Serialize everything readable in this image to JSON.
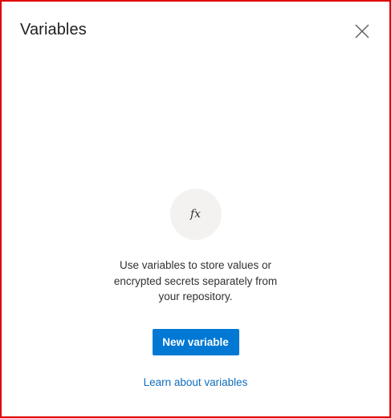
{
  "dialog": {
    "title": "Variables",
    "close_icon": "close-icon"
  },
  "empty_state": {
    "icon_text": "fx",
    "message": "Use variables to store values or encrypted secrets separately from your repository.",
    "new_button_label": "New variable",
    "learn_link_label": "Learn about variables"
  },
  "colors": {
    "accent": "#0078d4",
    "link": "#106ebe",
    "icon_bg": "#f3f2f1",
    "border": "#e00000"
  }
}
